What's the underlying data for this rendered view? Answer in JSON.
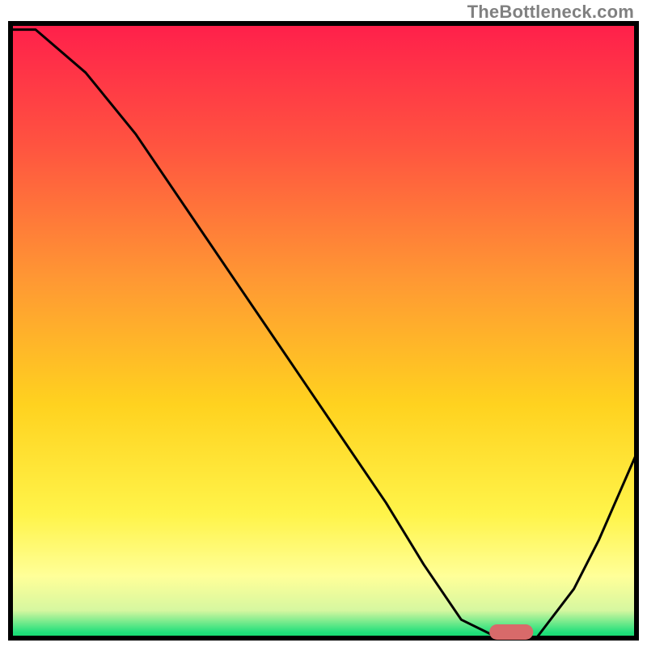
{
  "watermark": "TheBottleneck.com",
  "chart_data": {
    "type": "line",
    "title": "",
    "xlabel": "",
    "ylabel": "",
    "xlim": [
      0,
      100
    ],
    "ylim": [
      0,
      100
    ],
    "x": [
      0,
      4,
      12,
      20,
      28,
      36,
      44,
      52,
      60,
      66,
      72,
      78,
      84,
      90,
      94,
      100
    ],
    "values": [
      99,
      99,
      92,
      82,
      70,
      58,
      46,
      34,
      22,
      12,
      3,
      0,
      0,
      8,
      16,
      30
    ],
    "marker": {
      "x": 80,
      "width": 7,
      "height": 2.5,
      "color": "#d86a6a"
    },
    "gradient_stops": [
      {
        "offset": 0.0,
        "color": "#ff1f4b"
      },
      {
        "offset": 0.2,
        "color": "#ff5440"
      },
      {
        "offset": 0.42,
        "color": "#ff9933"
      },
      {
        "offset": 0.62,
        "color": "#ffd21f"
      },
      {
        "offset": 0.8,
        "color": "#fff44a"
      },
      {
        "offset": 0.9,
        "color": "#ffff99"
      },
      {
        "offset": 0.955,
        "color": "#d6f7a0"
      },
      {
        "offset": 0.99,
        "color": "#24e07c"
      },
      {
        "offset": 1.0,
        "color": "#0fd86b"
      }
    ],
    "frame": {
      "stroke": "#000000",
      "strokeWidth": 6
    },
    "line": {
      "stroke": "#000000",
      "strokeWidth": 3
    }
  }
}
